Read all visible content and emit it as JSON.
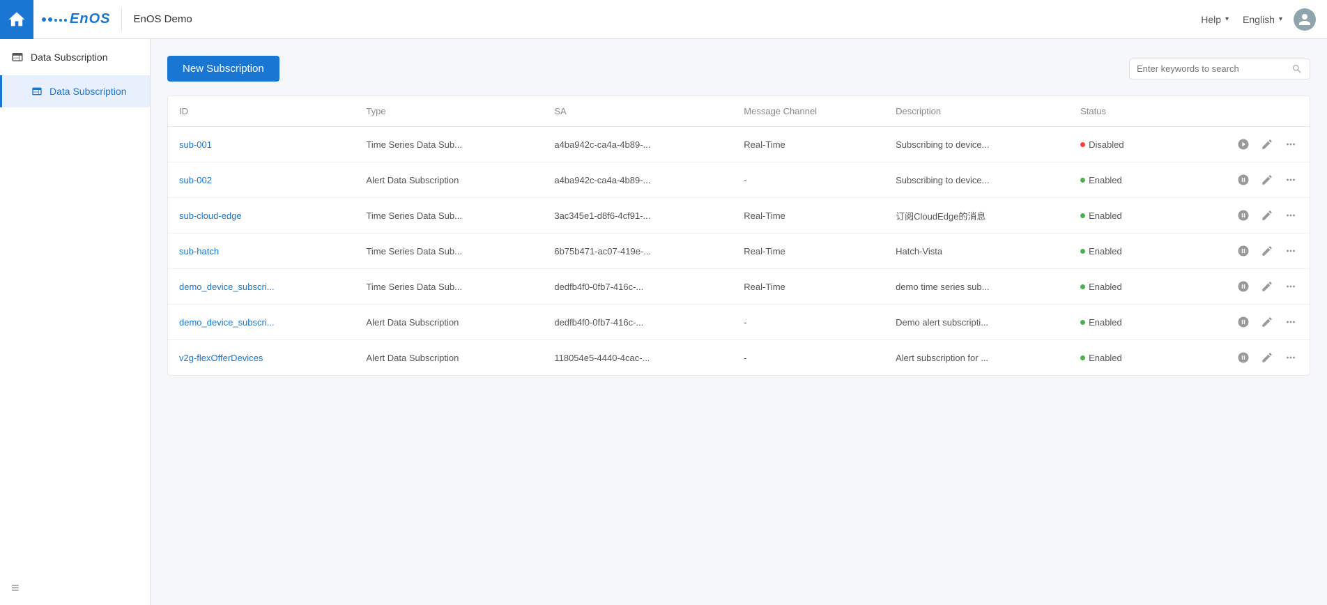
{
  "topnav": {
    "app_title": "EnOS Demo",
    "help_label": "Help",
    "lang_label": "English",
    "enos_label": "EnOS"
  },
  "sidebar": {
    "group_label": "Data Subscription",
    "active_item_label": "Data Subscription",
    "menu_icon": "≡"
  },
  "toolbar": {
    "new_subscription_label": "New Subscription",
    "search_placeholder": "Enter keywords to search"
  },
  "table": {
    "columns": [
      "ID",
      "Type",
      "SA",
      "Message Channel",
      "Description",
      "Status"
    ],
    "rows": [
      {
        "id": "sub-001",
        "type": "Time Series Data Sub...",
        "sa": "a4ba942c-ca4a-4b89-...",
        "message_channel": "Real-Time",
        "description": "Subscribing to device...",
        "status": "Disabled",
        "status_type": "disabled"
      },
      {
        "id": "sub-002",
        "type": "Alert Data Subscription",
        "sa": "a4ba942c-ca4a-4b89-...",
        "message_channel": "-",
        "description": "Subscribing to device...",
        "status": "Enabled",
        "status_type": "enabled"
      },
      {
        "id": "sub-cloud-edge",
        "type": "Time Series Data Sub...",
        "sa": "3ac345e1-d8f6-4cf91-...",
        "message_channel": "Real-Time",
        "description": "订阅CloudEdge的消息",
        "status": "Enabled",
        "status_type": "enabled"
      },
      {
        "id": "sub-hatch",
        "type": "Time Series Data Sub...",
        "sa": "6b75b471-ac07-419e-...",
        "message_channel": "Real-Time",
        "description": "Hatch-Vista",
        "status": "Enabled",
        "status_type": "enabled"
      },
      {
        "id": "demo_device_subscri...",
        "type": "Time Series Data Sub...",
        "sa": "dedfb4f0-0fb7-416c-...",
        "message_channel": "Real-Time",
        "description": "demo time series sub...",
        "status": "Enabled",
        "status_type": "enabled"
      },
      {
        "id": "demo_device_subscri...",
        "type": "Alert Data Subscription",
        "sa": "dedfb4f0-0fb7-416c-...",
        "message_channel": "-",
        "description": "Demo alert subscripti...",
        "status": "Enabled",
        "status_type": "enabled"
      },
      {
        "id": "v2g-flexOfferDevices",
        "type": "Alert Data Subscription",
        "sa": "118054e5-4440-4cac-...",
        "message_channel": "-",
        "description": "Alert subscription for ...",
        "status": "Enabled",
        "status_type": "enabled"
      }
    ]
  }
}
